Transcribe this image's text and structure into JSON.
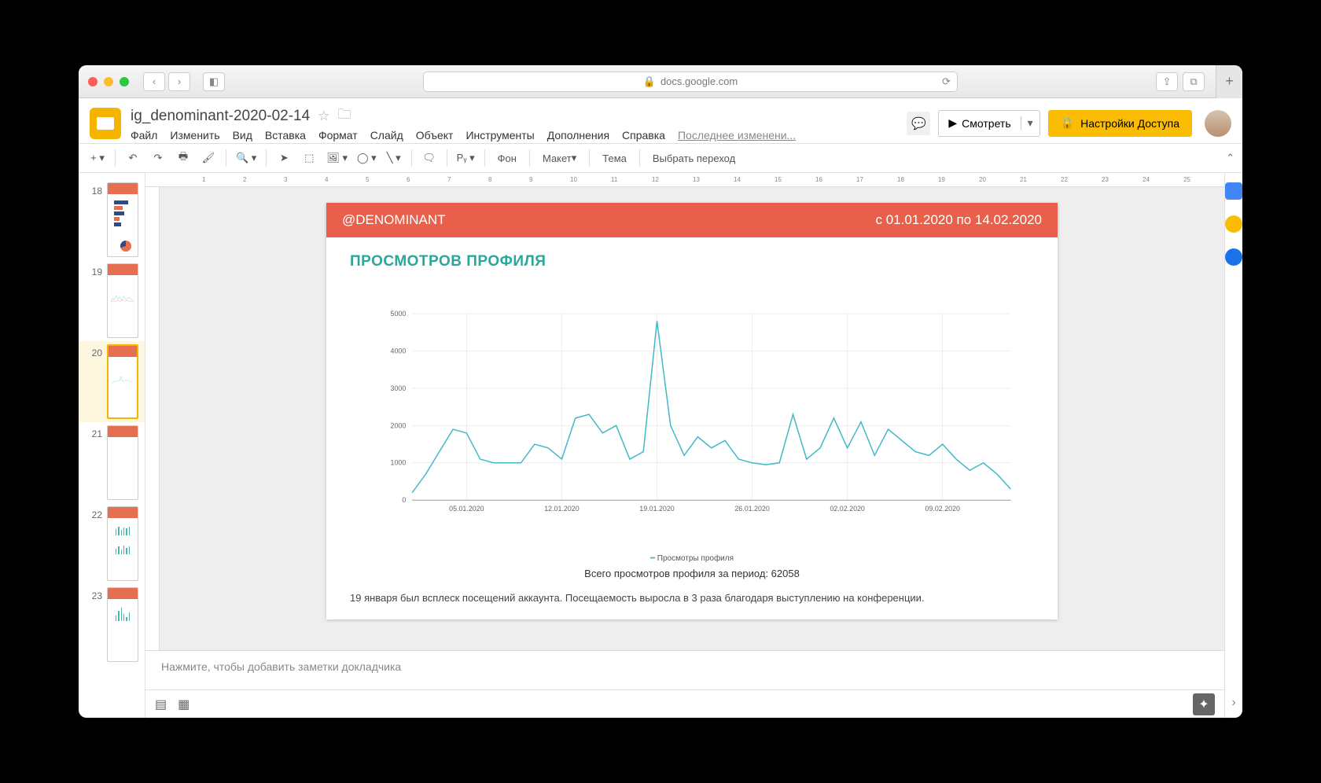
{
  "browser": {
    "url_display": "docs.google.com",
    "lock": "🔒"
  },
  "doc": {
    "title": "ig_denominant-2020-02-14",
    "last_edit": "Последнее изменени..."
  },
  "menu": {
    "file": "Файл",
    "edit": "Изменить",
    "view": "Вид",
    "insert": "Вставка",
    "format": "Формат",
    "slide": "Слайд",
    "object": "Объект",
    "tools": "Инструменты",
    "addons": "Дополнения",
    "help": "Справка"
  },
  "header_buttons": {
    "present": "Смотреть",
    "share": "Настройки Доступа"
  },
  "toolbar": {
    "background": "Фон",
    "layout": "Макет",
    "theme": "Тема",
    "transition": "Выбрать переход"
  },
  "ruler": [
    "",
    "1",
    "2",
    "3",
    "4",
    "5",
    "6",
    "7",
    "8",
    "9",
    "10",
    "11",
    "12",
    "13",
    "14",
    "15",
    "16",
    "17",
    "18",
    "19",
    "20",
    "21",
    "22",
    "23",
    "24",
    "25"
  ],
  "filmstrip": {
    "slides": [
      {
        "num": "18"
      },
      {
        "num": "19"
      },
      {
        "num": "20",
        "selected": true
      },
      {
        "num": "21"
      },
      {
        "num": "22"
      },
      {
        "num": "23"
      }
    ]
  },
  "slide": {
    "handle": "@DENOMINANT",
    "date_range": "с 01.01.2020 по 14.02.2020",
    "section_title": "ПРОСМОТРОВ ПРОФИЛЯ",
    "legend": "Просмотры профиля",
    "total_caption": "Всего просмотров профиля за период: 62058",
    "commentary": "19 января был всплеск посещений аккаунта. Посещаемость выросла в 3 раза благодаря выступлению на конференции."
  },
  "notes_placeholder": "Нажмите, чтобы добавить заметки докладчика",
  "chart_data": {
    "type": "line",
    "title": "ПРОСМОТРОВ ПРОФИЛЯ",
    "xlabel": "",
    "ylabel": "",
    "ylim": [
      0,
      5000
    ],
    "y_ticks": [
      0,
      1000,
      2000,
      3000,
      4000,
      5000
    ],
    "x_tick_labels": [
      "05.01.2020",
      "12.01.2020",
      "19.01.2020",
      "26.01.2020",
      "02.02.2020",
      "09.02.2020"
    ],
    "series": [
      {
        "name": "Просмотры профиля",
        "color": "#3fb8c8",
        "x": [
          "01.01",
          "02.01",
          "03.01",
          "04.01",
          "05.01",
          "06.01",
          "07.01",
          "08.01",
          "09.01",
          "10.01",
          "11.01",
          "12.01",
          "13.01",
          "14.01",
          "15.01",
          "16.01",
          "17.01",
          "18.01",
          "19.01",
          "20.01",
          "21.01",
          "22.01",
          "23.01",
          "24.01",
          "25.01",
          "26.01",
          "27.01",
          "28.01",
          "29.01",
          "30.01",
          "31.01",
          "01.02",
          "02.02",
          "03.02",
          "04.02",
          "05.02",
          "06.02",
          "07.02",
          "08.02",
          "09.02",
          "10.02",
          "11.02",
          "12.02",
          "13.02",
          "14.02"
        ],
        "values": [
          200,
          700,
          1300,
          1900,
          1800,
          1100,
          1000,
          1000,
          1000,
          1500,
          1400,
          1100,
          2200,
          2300,
          1800,
          2000,
          1100,
          1300,
          4800,
          2000,
          1200,
          1700,
          1400,
          1600,
          1100,
          1000,
          950,
          1000,
          2300,
          1100,
          1400,
          2200,
          1400,
          2100,
          1200,
          1900,
          1600,
          1300,
          1200,
          1500,
          1100,
          800,
          1000,
          700,
          300
        ]
      }
    ]
  }
}
